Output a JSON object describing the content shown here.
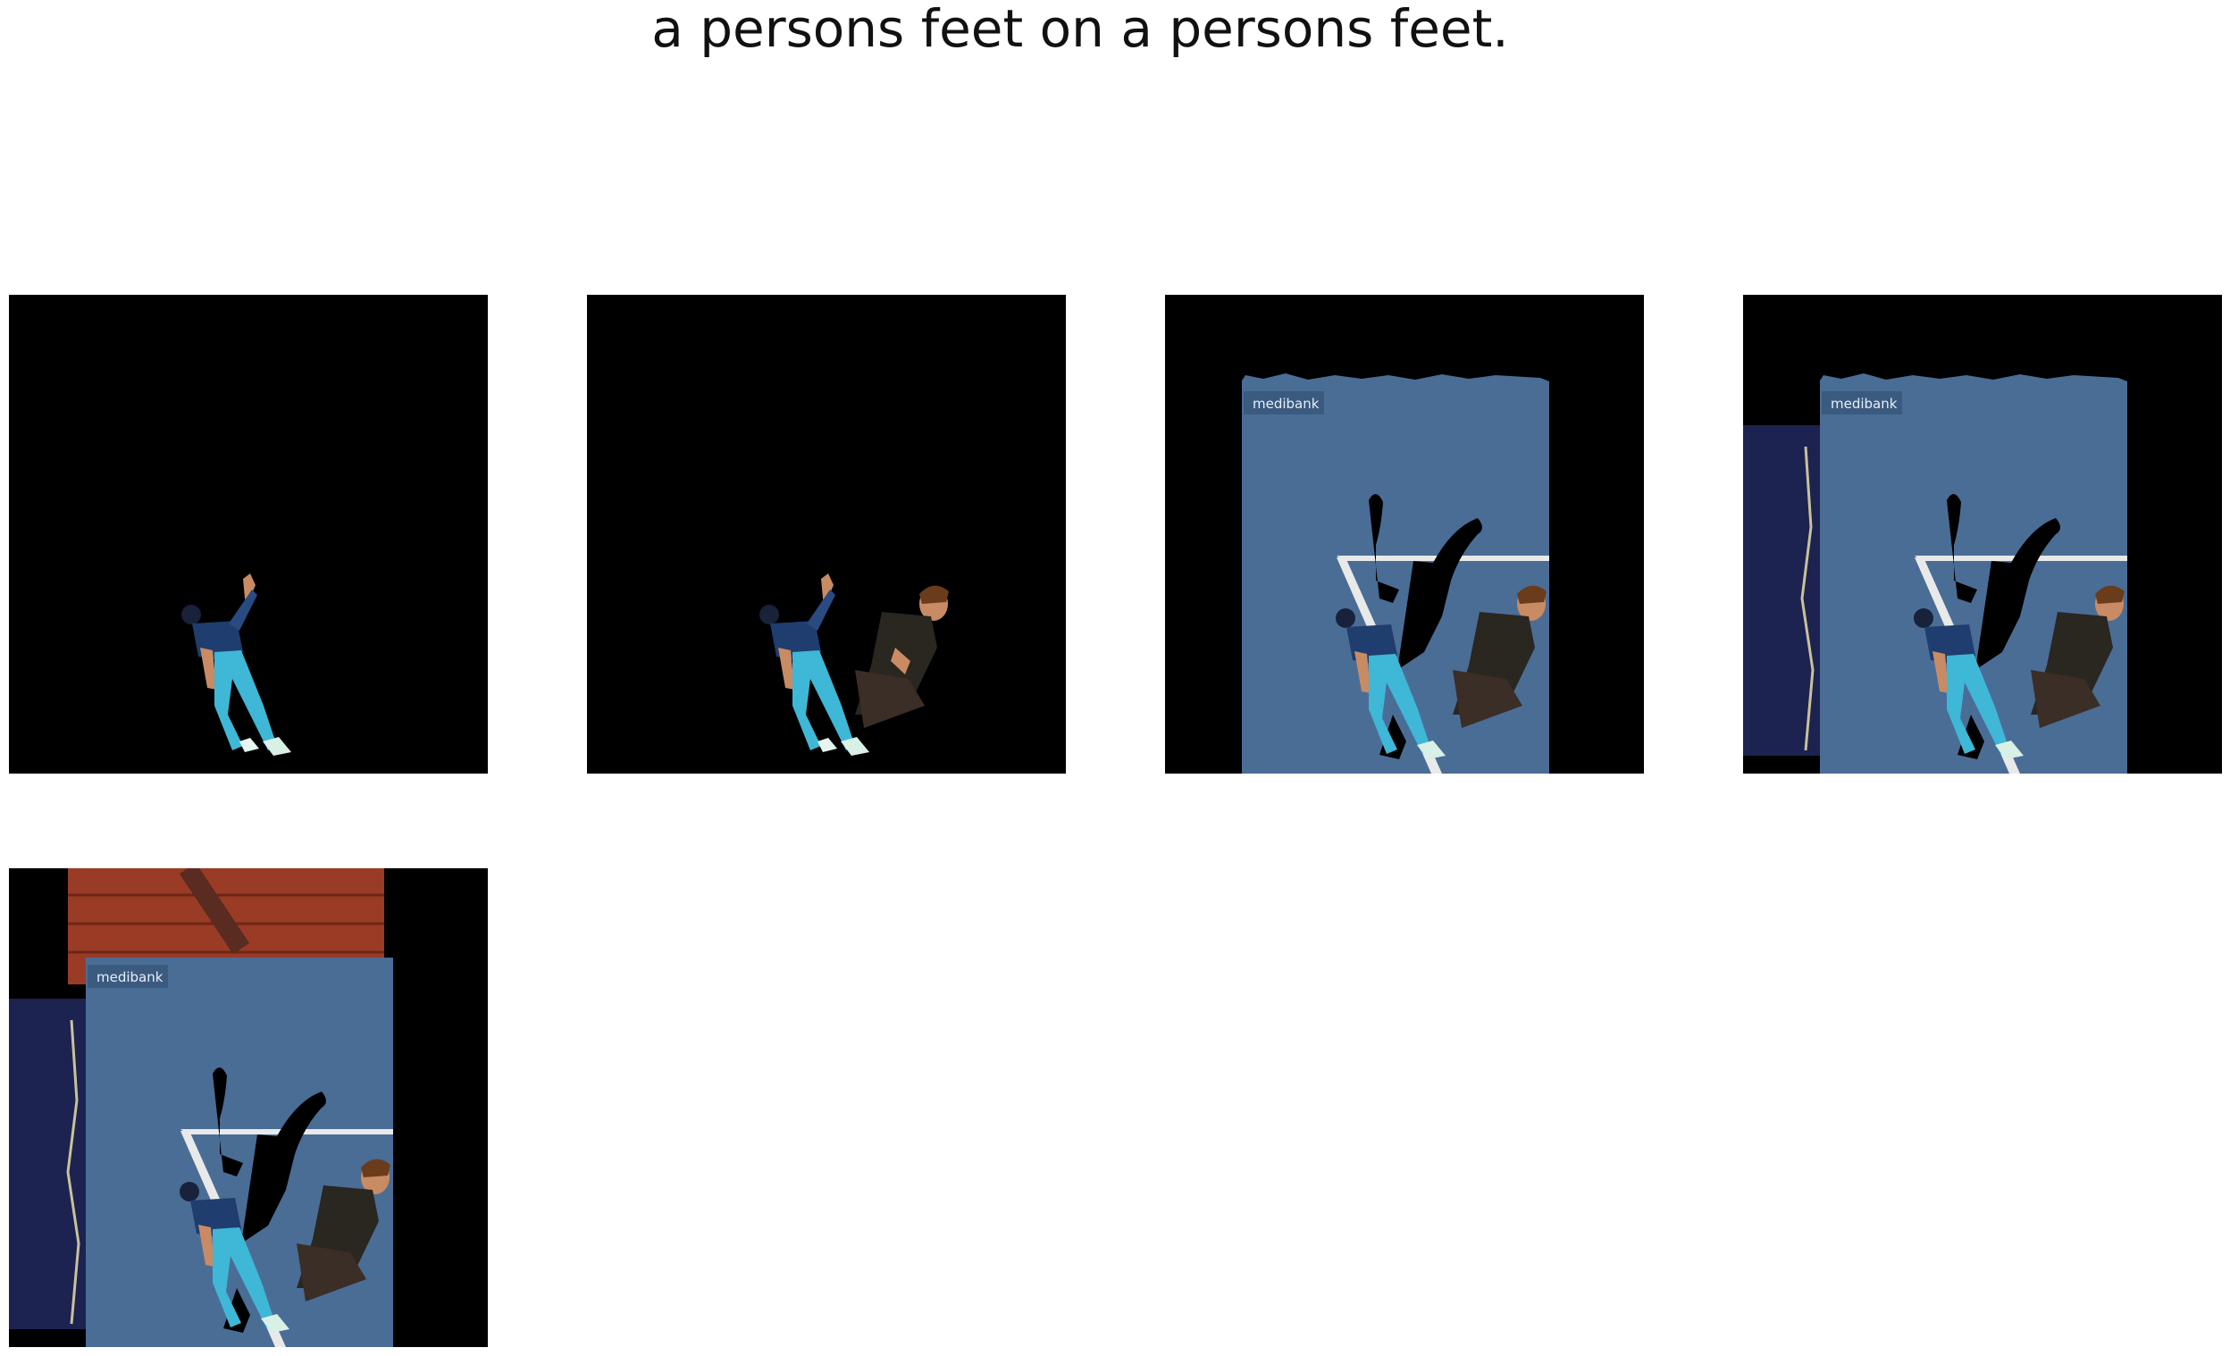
{
  "figure": {
    "title": "a persons feet on a persons feet."
  },
  "overlays": {
    "banner_text": "medibank"
  },
  "colors": {
    "background": "#000000",
    "court": "#4a6d96",
    "court_line": "#e9e9e9",
    "shirt_left": "#1f3d6e",
    "jeans_left": "#3fb7d6",
    "shirt_right": "#2a2620",
    "skin": "#c98b63",
    "night_sky": "#1c2350",
    "brick": "#9a3b26"
  }
}
